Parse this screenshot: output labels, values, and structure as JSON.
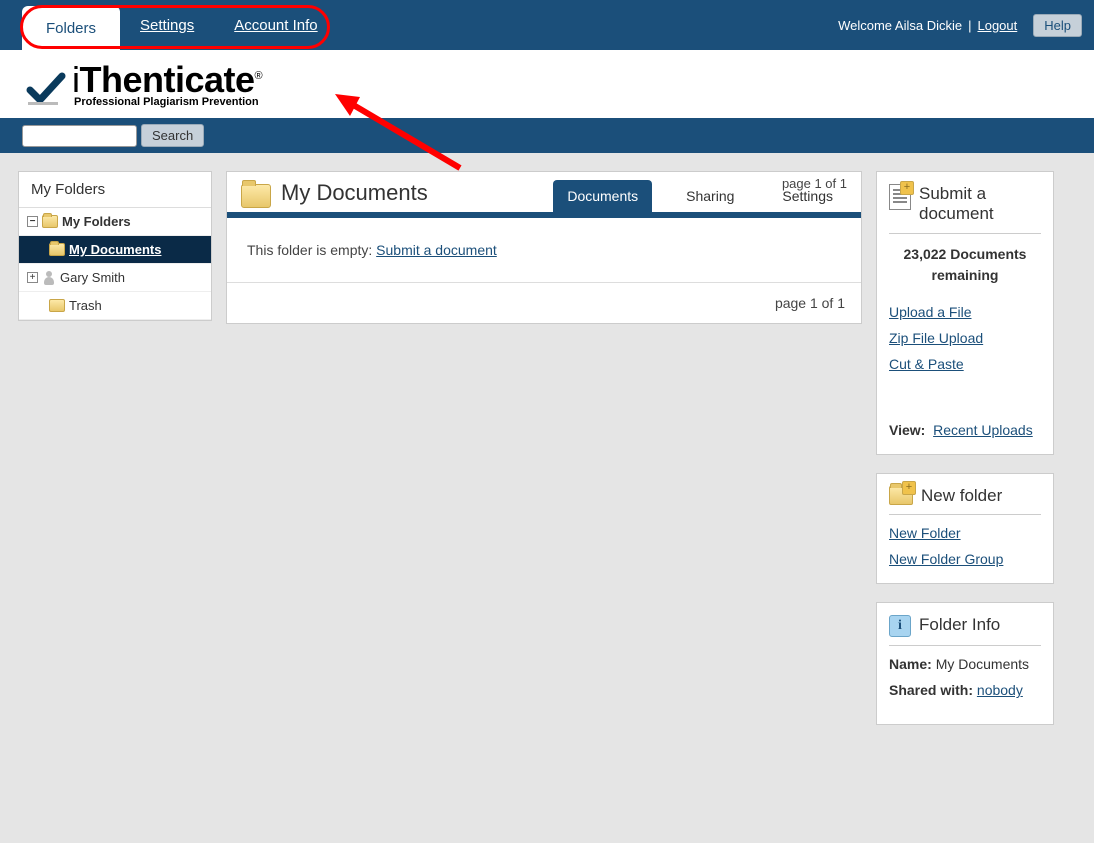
{
  "topbar": {
    "tabs": [
      {
        "label": "Folders",
        "active": true
      },
      {
        "label": "Settings",
        "active": false
      },
      {
        "label": "Account Info",
        "active": false
      }
    ],
    "welcome_prefix": "Welcome ",
    "user_name": "Ailsa Dickie",
    "separator": " | ",
    "logout": "Logout",
    "help": "Help"
  },
  "logo": {
    "prefix": "i",
    "main": "Thenticate",
    "tagline": "Professional Plagiarism Prevention"
  },
  "search": {
    "button": "Search",
    "placeholder": ""
  },
  "sidebar": {
    "header": "My Folders",
    "items": [
      {
        "type": "root",
        "label": "My Folders",
        "toggle": "−"
      },
      {
        "type": "selected",
        "label": "My Documents"
      },
      {
        "type": "user",
        "label": "Gary Smith",
        "toggle": "+"
      },
      {
        "type": "trash",
        "label": "Trash"
      }
    ]
  },
  "main": {
    "title": "My Documents",
    "page_info": "page 1 of 1",
    "tabs": [
      {
        "label": "Documents",
        "active": true
      },
      {
        "label": "Sharing",
        "active": false
      },
      {
        "label": "Settings",
        "active": false
      }
    ],
    "empty_prefix": "This folder is empty: ",
    "empty_link": "Submit a document",
    "page_info_bottom": "page 1 of 1"
  },
  "submit_card": {
    "title": "Submit a document",
    "remaining_count": "23,022",
    "remaining_label": " Documents remaining",
    "links": [
      "Upload a File",
      "Zip File Upload",
      "Cut & Paste"
    ],
    "view_label": "View:",
    "view_link": "Recent Uploads"
  },
  "newfolder_card": {
    "title": "New folder",
    "links": [
      "New Folder",
      "New Folder Group"
    ]
  },
  "info_card": {
    "title": "Folder Info",
    "name_label": "Name:",
    "name_value": "My Documents",
    "shared_label": "Shared with:",
    "shared_value": "nobody"
  }
}
